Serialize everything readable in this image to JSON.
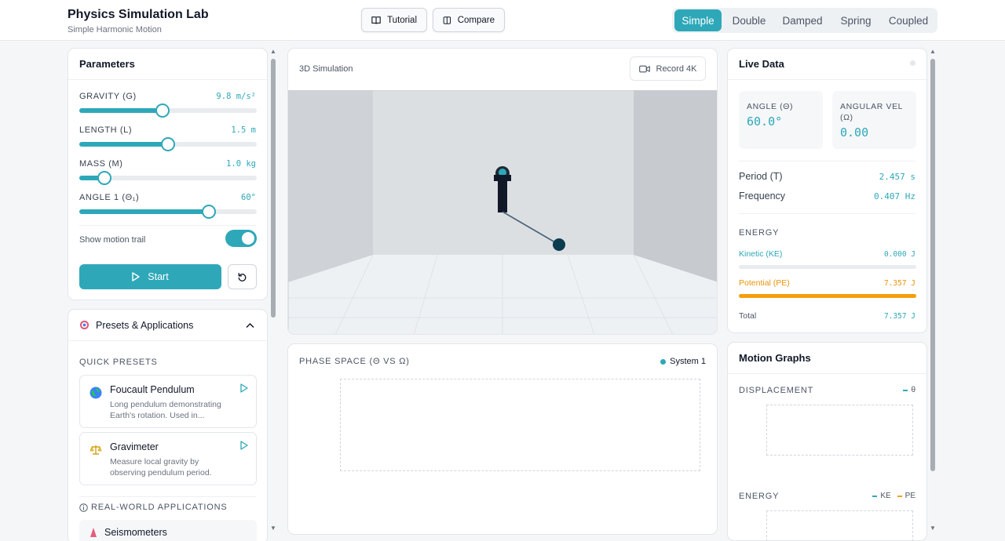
{
  "header": {
    "title": "Physics Simulation Lab",
    "subtitle": "Simple Harmonic Motion",
    "tutorial_label": "Tutorial",
    "compare_label": "Compare",
    "modes": [
      "Simple",
      "Double",
      "Damped",
      "Spring",
      "Coupled"
    ],
    "active_mode": "Simple"
  },
  "params": {
    "title": "Parameters",
    "sliders": [
      {
        "label": "GRAVITY (G)",
        "value": "9.8 m/s²",
        "fraction": 0.47
      },
      {
        "label": "LENGTH (L)",
        "value": "1.5 m",
        "fraction": 0.5
      },
      {
        "label": "MASS (M)",
        "value": "1.0 kg",
        "fraction": 0.14
      },
      {
        "label": "ANGLE 1 (Θ₁)",
        "value": "60°",
        "fraction": 0.73
      }
    ],
    "trail_label": "Show motion trail",
    "trail_on": true,
    "start_label": "Start"
  },
  "presets": {
    "title": "Presets & Applications",
    "quick_label": "QUICK PRESETS",
    "items": [
      {
        "title": "Foucault Pendulum",
        "desc": "Long pendulum demonstrating Earth's rotation. Used in..."
      },
      {
        "title": "Gravimeter",
        "desc": "Measure local gravity by observing pendulum period."
      }
    ],
    "realworld_label": "REAL-WORLD APPLICATIONS",
    "apps": [
      "Seismometers"
    ]
  },
  "sim": {
    "title": "3D Simulation",
    "record_label": "Record 4K"
  },
  "phase": {
    "title": "PHASE SPACE (Θ VS Ω)",
    "legend": "System 1"
  },
  "live": {
    "title": "Live Data",
    "angle_label": "ANGLE (Θ)",
    "angle_value": "60.0°",
    "angvel_label": "ANGULAR VEL (Ω)",
    "angvel_value": "0.00",
    "period_label": "Period (T)",
    "period_value": "2.457 s",
    "freq_label": "Frequency",
    "freq_value": "0.407 Hz",
    "energy_label": "ENERGY",
    "ke_label": "Kinetic (KE)",
    "ke_value": "0.000 J",
    "ke_fraction": 0,
    "pe_label": "Potential (PE)",
    "pe_value": "7.357 J",
    "pe_fraction": 1,
    "total_label": "Total",
    "total_value": "7.357 J"
  },
  "graphs": {
    "title": "Motion Graphs",
    "displacement_label": "DISPLACEMENT",
    "displacement_legend": "θ",
    "energy_label": "ENERGY",
    "ke_legend": "KE",
    "pe_legend": "PE"
  },
  "colors": {
    "accent": "#2ea8b8",
    "potential": "#f59e0b"
  }
}
